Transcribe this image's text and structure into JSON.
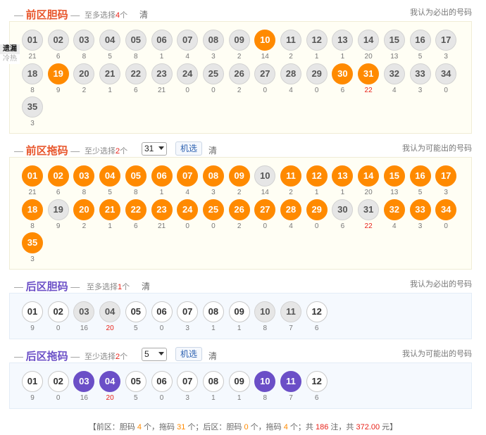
{
  "front_dan": {
    "title": "前区胆码",
    "hint_pre": "至多选择",
    "hint_num": "4",
    "hint_post": "个",
    "clear": "清",
    "right": "我认为必出的号码",
    "balls": [
      {
        "n": "01",
        "c": "21",
        "s": "dim"
      },
      {
        "n": "02",
        "c": "6",
        "s": "dim"
      },
      {
        "n": "03",
        "c": "8",
        "s": "dim"
      },
      {
        "n": "04",
        "c": "5",
        "s": "dim"
      },
      {
        "n": "05",
        "c": "8",
        "s": "dim"
      },
      {
        "n": "06",
        "c": "1",
        "s": "dim"
      },
      {
        "n": "07",
        "c": "4",
        "s": "dim"
      },
      {
        "n": "08",
        "c": "3",
        "s": "dim"
      },
      {
        "n": "09",
        "c": "2",
        "s": "dim"
      },
      {
        "n": "10",
        "c": "14",
        "s": "orange"
      },
      {
        "n": "11",
        "c": "2",
        "s": "dim"
      },
      {
        "n": "12",
        "c": "1",
        "s": "dim"
      },
      {
        "n": "13",
        "c": "1",
        "s": "dim"
      },
      {
        "n": "14",
        "c": "20",
        "s": "dim"
      },
      {
        "n": "15",
        "c": "13",
        "s": "dim"
      },
      {
        "n": "16",
        "c": "5",
        "s": "dim"
      },
      {
        "n": "17",
        "c": "3",
        "s": "dim"
      },
      {
        "n": "18",
        "c": "8",
        "s": "dim"
      },
      {
        "n": "19",
        "c": "9",
        "s": "orange"
      },
      {
        "n": "20",
        "c": "2",
        "s": "dim"
      },
      {
        "n": "21",
        "c": "1",
        "s": "dim"
      },
      {
        "n": "22",
        "c": "6",
        "s": "dim"
      },
      {
        "n": "23",
        "c": "21",
        "s": "dim"
      },
      {
        "n": "24",
        "c": "0",
        "s": "dim"
      },
      {
        "n": "25",
        "c": "0",
        "s": "dim"
      },
      {
        "n": "26",
        "c": "2",
        "s": "dim"
      },
      {
        "n": "27",
        "c": "0",
        "s": "dim"
      },
      {
        "n": "28",
        "c": "4",
        "s": "dim"
      },
      {
        "n": "29",
        "c": "0",
        "s": "dim"
      },
      {
        "n": "30",
        "c": "6",
        "s": "orange"
      },
      {
        "n": "31",
        "c": "22",
        "s": "orange",
        "hot": true
      },
      {
        "n": "32",
        "c": "4",
        "s": "dim"
      },
      {
        "n": "33",
        "c": "3",
        "s": "dim"
      },
      {
        "n": "34",
        "c": "0",
        "s": "dim"
      },
      {
        "n": "35",
        "c": "3",
        "s": "dim"
      }
    ]
  },
  "side_tabs": {
    "a": "遗漏",
    "b": "冷热"
  },
  "front_tuo": {
    "title": "前区拖码",
    "hint_pre": "至少选择",
    "hint_num": "2",
    "hint_post": "个",
    "select_value": "31",
    "random_btn": "机选",
    "clear": "清",
    "right": "我认为可能出的号码",
    "balls": [
      {
        "n": "01",
        "c": "21",
        "s": "orange"
      },
      {
        "n": "02",
        "c": "6",
        "s": "orange"
      },
      {
        "n": "03",
        "c": "8",
        "s": "orange"
      },
      {
        "n": "04",
        "c": "5",
        "s": "orange"
      },
      {
        "n": "05",
        "c": "8",
        "s": "orange"
      },
      {
        "n": "06",
        "c": "1",
        "s": "orange"
      },
      {
        "n": "07",
        "c": "4",
        "s": "orange"
      },
      {
        "n": "08",
        "c": "3",
        "s": "orange"
      },
      {
        "n": "09",
        "c": "2",
        "s": "orange"
      },
      {
        "n": "10",
        "c": "14",
        "s": "dim"
      },
      {
        "n": "11",
        "c": "2",
        "s": "orange"
      },
      {
        "n": "12",
        "c": "1",
        "s": "orange"
      },
      {
        "n": "13",
        "c": "1",
        "s": "orange"
      },
      {
        "n": "14",
        "c": "20",
        "s": "orange"
      },
      {
        "n": "15",
        "c": "13",
        "s": "orange"
      },
      {
        "n": "16",
        "c": "5",
        "s": "orange"
      },
      {
        "n": "17",
        "c": "3",
        "s": "orange"
      },
      {
        "n": "18",
        "c": "8",
        "s": "orange"
      },
      {
        "n": "19",
        "c": "9",
        "s": "dim"
      },
      {
        "n": "20",
        "c": "2",
        "s": "orange"
      },
      {
        "n": "21",
        "c": "1",
        "s": "orange"
      },
      {
        "n": "22",
        "c": "6",
        "s": "orange"
      },
      {
        "n": "23",
        "c": "21",
        "s": "orange"
      },
      {
        "n": "24",
        "c": "0",
        "s": "orange"
      },
      {
        "n": "25",
        "c": "0",
        "s": "orange"
      },
      {
        "n": "26",
        "c": "2",
        "s": "orange"
      },
      {
        "n": "27",
        "c": "0",
        "s": "orange"
      },
      {
        "n": "28",
        "c": "4",
        "s": "orange"
      },
      {
        "n": "29",
        "c": "0",
        "s": "orange"
      },
      {
        "n": "30",
        "c": "6",
        "s": "dim"
      },
      {
        "n": "31",
        "c": "22",
        "s": "dim",
        "hot": true
      },
      {
        "n": "32",
        "c": "4",
        "s": "orange"
      },
      {
        "n": "33",
        "c": "3",
        "s": "orange"
      },
      {
        "n": "34",
        "c": "0",
        "s": "orange"
      },
      {
        "n": "35",
        "c": "3",
        "s": "orange"
      }
    ]
  },
  "back_dan": {
    "title": "后区胆码",
    "hint_pre": "至多选择",
    "hint_num": "1",
    "hint_post": "个",
    "clear": "清",
    "right": "我认为必出的号码",
    "balls": [
      {
        "n": "01",
        "c": "9",
        "s": "norm"
      },
      {
        "n": "02",
        "c": "0",
        "s": "norm"
      },
      {
        "n": "03",
        "c": "16",
        "s": "dim"
      },
      {
        "n": "04",
        "c": "20",
        "s": "dim",
        "hot": true
      },
      {
        "n": "05",
        "c": "5",
        "s": "norm"
      },
      {
        "n": "06",
        "c": "0",
        "s": "norm"
      },
      {
        "n": "07",
        "c": "3",
        "s": "norm"
      },
      {
        "n": "08",
        "c": "1",
        "s": "norm"
      },
      {
        "n": "09",
        "c": "1",
        "s": "norm"
      },
      {
        "n": "10",
        "c": "8",
        "s": "dim"
      },
      {
        "n": "11",
        "c": "7",
        "s": "dim"
      },
      {
        "n": "12",
        "c": "6",
        "s": "norm"
      }
    ]
  },
  "back_tuo": {
    "title": "后区拖码",
    "hint_pre": "至少选择",
    "hint_num": "2",
    "hint_post": "个",
    "select_value": "5",
    "random_btn": "机选",
    "clear": "清",
    "right": "我认为可能出的号码",
    "balls": [
      {
        "n": "01",
        "c": "9",
        "s": "norm"
      },
      {
        "n": "02",
        "c": "0",
        "s": "norm"
      },
      {
        "n": "03",
        "c": "16",
        "s": "purple"
      },
      {
        "n": "04",
        "c": "20",
        "s": "purple",
        "hot": true
      },
      {
        "n": "05",
        "c": "5",
        "s": "norm"
      },
      {
        "n": "06",
        "c": "0",
        "s": "norm"
      },
      {
        "n": "07",
        "c": "3",
        "s": "norm"
      },
      {
        "n": "08",
        "c": "1",
        "s": "norm"
      },
      {
        "n": "09",
        "c": "1",
        "s": "norm"
      },
      {
        "n": "10",
        "c": "8",
        "s": "purple"
      },
      {
        "n": "11",
        "c": "7",
        "s": "purple"
      },
      {
        "n": "12",
        "c": "6",
        "s": "norm"
      }
    ]
  },
  "summary": {
    "p1": "【前区：胆码 ",
    "front_dan": "4",
    "p2": " 个，拖码 ",
    "front_tuo": "31",
    "p3": " 个；后区：胆码 ",
    "back_dan": "0",
    "p4": " 个，拖码 ",
    "back_tuo": "4",
    "p5": " 个；共 ",
    "bets": "186",
    "p6": " 注，共 ",
    "amount": "372.00",
    "p7": " 元】"
  }
}
